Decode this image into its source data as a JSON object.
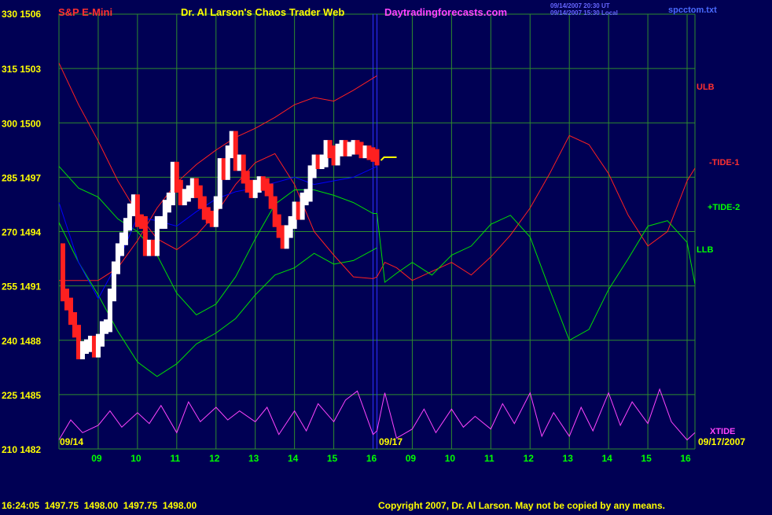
{
  "header": {
    "symbol": "S&P E-Mini",
    "title": "Dr. Al Larson's Chaos Trader Web",
    "site": "Daytradingforecasts.com",
    "timestamp_1": "09/14/2007 20:30 UT",
    "timestamp_2": "09/14/2007 15:30 Local",
    "file": "spcctom.txt"
  },
  "footer": {
    "quote": "16:24:05  1497.75  1498.00  1497.75  1498.00",
    "copyright": "Copyright 2007, Dr. Al Larson. May not be copied by any means."
  },
  "date_labels": {
    "start": "09/14",
    "mid": "09/17",
    "end": "09/17/2007"
  },
  "series_labels": {
    "ulb": "ULB",
    "tide1": "-TIDE-1",
    "tide2": "+TIDE-2",
    "llb": "LLB",
    "xtide": "XTIDE"
  },
  "colors": {
    "background": "#000054",
    "grid": "#2e8b2e",
    "axis_text": "#ffff00",
    "hour_text": "#00ff00",
    "price_up": "#ffffff",
    "price_down": "#ff2020",
    "ulb": "#ff2020",
    "tide1": "#ff2020",
    "tide2": "#00e000",
    "llb": "#00e000",
    "xtide": "#ff44ff",
    "ma": "#0000ff",
    "site": "#ff44ff"
  },
  "chart_data": {
    "type": "line",
    "x_ticks": [
      "09",
      "10",
      "11",
      "12",
      "13",
      "14",
      "15",
      "16",
      "09",
      "10",
      "11",
      "12",
      "13",
      "14",
      "15",
      "16"
    ],
    "y_ticks": [
      {
        "left": "330",
        "right": "1506"
      },
      {
        "left": "315",
        "right": "1503"
      },
      {
        "left": "300",
        "right": "1500"
      },
      {
        "left": "285",
        "right": "1497"
      },
      {
        "left": "270",
        "right": "1494"
      },
      {
        "left": "255",
        "right": "1491"
      },
      {
        "left": "240",
        "right": "1488"
      },
      {
        "left": "225",
        "right": "1485"
      },
      {
        "left": "210",
        "right": "1482"
      }
    ],
    "price_range": [
      1482,
      1506
    ],
    "x_range": [
      0,
      16.2
    ],
    "grid": true,
    "series": [
      {
        "name": "ULB",
        "role": "red-upper",
        "x": [
          0,
          0.5,
          1,
          1.5,
          2,
          2.5,
          3,
          3.5,
          4,
          4.5,
          5,
          5.5,
          6,
          6.5,
          7,
          7.5,
          8.1
        ],
        "y": [
          1491.3,
          1491.3,
          1491.3,
          1492,
          1493.5,
          1495.3,
          1496.7,
          1497.7,
          1498.5,
          1499.2,
          1499.7,
          1500.3,
          1501,
          1501.4,
          1501.2,
          1501.8,
          1502.6
        ]
      },
      {
        "name": "LLB",
        "role": "green-lower",
        "x": [
          0,
          0.5,
          1,
          1.5,
          2,
          2.5,
          3,
          3.5,
          4,
          4.5,
          5,
          5.5,
          6,
          6.5,
          7,
          7.5,
          8.1
        ],
        "y": [
          1494.5,
          1492.3,
          1490.5,
          1488.5,
          1486.8,
          1486,
          1486.7,
          1487.8,
          1488.4,
          1489.2,
          1490.5,
          1491.6,
          1492,
          1492.8,
          1492.2,
          1492.4,
          1493.1
        ]
      },
      {
        "name": "-TIDE-1",
        "role": "red-tide",
        "x": [
          0,
          0.5,
          1,
          1.5,
          2,
          2.5,
          3,
          3.5,
          4,
          4.5,
          5,
          5.5,
          6,
          6.5,
          7,
          7.5,
          8,
          8.1,
          8.3,
          8.6,
          9,
          9.5,
          10,
          10.5,
          11,
          11.5,
          12,
          12.5,
          13,
          13.5,
          14,
          14.5,
          15,
          15.5,
          16,
          16.2
        ],
        "y": [
          1503.3,
          1501,
          1499,
          1496.8,
          1495,
          1493.6,
          1493,
          1493.8,
          1495,
          1496.6,
          1497.8,
          1498.3,
          1496.6,
          1494,
          1492.7,
          1491.5,
          1491.4,
          1491.5,
          1492.3,
          1492,
          1491.3,
          1491.8,
          1492.3,
          1491.6,
          1492.6,
          1493.8,
          1495.3,
          1497.2,
          1499.3,
          1498.8,
          1497.2,
          1494.9,
          1493.2,
          1494,
          1496.8,
          1497.5
        ]
      },
      {
        "name": "+TIDE-2",
        "role": "green-tide",
        "x": [
          0,
          0.5,
          1,
          1.5,
          2,
          2.5,
          3,
          3.5,
          4,
          4.5,
          5,
          5.5,
          6,
          6.5,
          7,
          7.5,
          8,
          8.1,
          8.3,
          8.6,
          9,
          9.5,
          10,
          10.5,
          11,
          11.5,
          12,
          12.5,
          13,
          13.5,
          14,
          14.5,
          15,
          15.5,
          16,
          16.2
        ],
        "y": [
          1497.6,
          1496.4,
          1495.9,
          1494.7,
          1494,
          1492.7,
          1490.6,
          1489.4,
          1490,
          1491.5,
          1493.6,
          1495.5,
          1496.3,
          1496.3,
          1496,
          1495.6,
          1495,
          1495,
          1491.2,
          1491.7,
          1492.3,
          1491.6,
          1492.7,
          1493.2,
          1494.4,
          1494.9,
          1493.7,
          1490.8,
          1488,
          1488.6,
          1490.8,
          1492.5,
          1494.3,
          1494.6,
          1493.4,
          1491.1
        ]
      },
      {
        "name": "XTIDE",
        "x": [
          0,
          0.3,
          0.6,
          1,
          1.3,
          1.6,
          2,
          2.3,
          2.6,
          3,
          3.3,
          3.6,
          4,
          4.3,
          4.6,
          5,
          5.3,
          5.6,
          6,
          6.3,
          6.6,
          7,
          7.3,
          7.6,
          8,
          8.1,
          8.3,
          8.6,
          9,
          9.3,
          9.6,
          10,
          10.3,
          10.6,
          11,
          11.3,
          11.6,
          12,
          12.3,
          12.6,
          13,
          13.3,
          13.6,
          14,
          14.3,
          14.6,
          15,
          15.3,
          15.6,
          16,
          16.2
        ],
        "y": [
          1482.5,
          1483.6,
          1482.9,
          1483.3,
          1484.1,
          1483.2,
          1484,
          1483.4,
          1484.4,
          1482.9,
          1484.6,
          1483.5,
          1484.3,
          1483.6,
          1484.1,
          1483.5,
          1484.3,
          1482.8,
          1484.1,
          1483,
          1484.5,
          1483.5,
          1484.7,
          1485.2,
          1482.8,
          1483,
          1485.1,
          1482.6,
          1483.1,
          1484.2,
          1482.9,
          1484.2,
          1483.2,
          1483.8,
          1483.1,
          1484.5,
          1483.4,
          1485.1,
          1482.7,
          1484,
          1482.7,
          1484.3,
          1483,
          1485.1,
          1483.3,
          1484.6,
          1483.4,
          1485.3,
          1483.5,
          1482.5,
          1482.9
        ]
      },
      {
        "name": "MA",
        "role": "blue",
        "x": [
          0,
          0.5,
          1,
          1.5,
          2,
          2.5,
          3,
          3.5,
          4,
          4.5,
          5,
          5.5,
          6,
          6.5,
          7,
          7.5,
          8.1
        ],
        "y": [
          1495.6,
          1492.3,
          1490.3,
          1492.3,
          1494.8,
          1494.6,
          1494.3,
          1495.1,
          1495.8,
          1496.2,
          1496.4,
          1496.7,
          1497,
          1496.6,
          1496.8,
          1497,
          1497.6
        ]
      },
      {
        "name": "Price",
        "x": [
          0,
          0.1,
          0.2,
          0.3,
          0.4,
          0.5,
          0.6,
          0.7,
          0.8,
          0.9,
          1,
          1.1,
          1.2,
          1.3,
          1.4,
          1.5,
          1.6,
          1.7,
          1.8,
          1.9,
          2,
          2.1,
          2.2,
          2.3,
          2.4,
          2.5,
          2.6,
          2.7,
          2.8,
          2.9,
          3,
          3.1,
          3.2,
          3.3,
          3.4,
          3.5,
          3.6,
          3.7,
          3.8,
          3.9,
          4,
          4.1,
          4.2,
          4.3,
          4.4,
          4.5,
          4.6,
          4.7,
          4.8,
          4.9,
          5,
          5.1,
          5.2,
          5.3,
          5.4,
          5.5,
          5.6,
          5.7,
          5.8,
          5.9,
          6,
          6.1,
          6.2,
          6.3,
          6.4,
          6.5,
          6.6,
          6.7,
          6.8,
          6.9,
          7,
          7.1,
          7.2,
          7.3,
          7.4,
          7.5,
          7.6,
          7.7,
          7.8,
          7.9,
          8,
          8.1
        ],
        "y": [
          1493,
          1490.5,
          1490,
          1489.2,
          1488.5,
          1487.3,
          1487.6,
          1487.7,
          1487.9,
          1487.4,
          1488,
          1488.7,
          1488.8,
          1490.5,
          1492,
          1493,
          1493.6,
          1494.4,
          1495.2,
          1495.7,
          1494.6,
          1494.5,
          1493,
          1493.2,
          1493,
          1494.5,
          1494.5,
          1495.4,
          1495.8,
          1497.5,
          1496.5,
          1495.8,
          1496,
          1496.2,
          1496.6,
          1496.2,
          1495.6,
          1495,
          1494.8,
          1494.6,
          1495.6,
          1497.7,
          1497.2,
          1498.4,
          1499.2,
          1497.7,
          1497.9,
          1497,
          1496.5,
          1496.2,
          1496.5,
          1496.7,
          1496.6,
          1496.3,
          1495.6,
          1494.6,
          1494,
          1493.4,
          1494,
          1494.5,
          1495.3,
          1495,
          1495.8,
          1496,
          1497.3,
          1497.9,
          1497.8,
          1497.9,
          1498.7,
          1498.4,
          1498,
          1498.5,
          1498.7,
          1498.5,
          1498.6,
          1498.7,
          1498.6,
          1498.4,
          1498.4,
          1498.3,
          1498.2,
          1498
        ]
      }
    ],
    "forecast_close": 1498.1
  }
}
